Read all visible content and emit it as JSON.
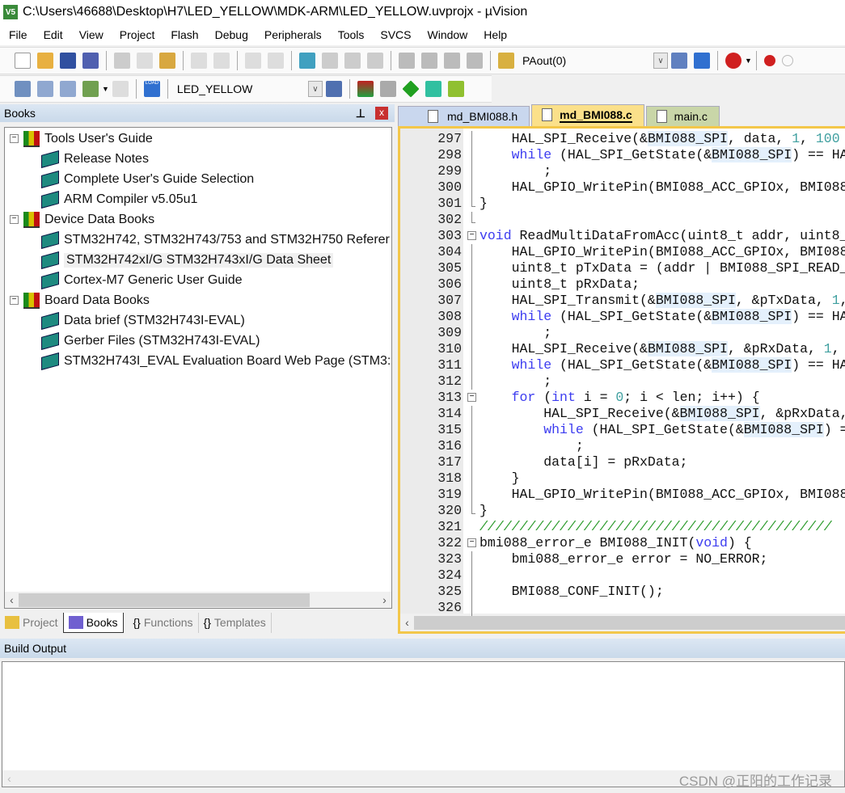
{
  "window": {
    "title": "C:\\Users\\46688\\Desktop\\H7\\LED_YELLOW\\MDK-ARM\\LED_YELLOW.uvprojx - µVision",
    "icon_text": "V5"
  },
  "menu": [
    "File",
    "Edit",
    "View",
    "Project",
    "Flash",
    "Debug",
    "Peripherals",
    "Tools",
    "SVCS",
    "Window",
    "Help"
  ],
  "toolbar1": {
    "find_value": "PAout(0)"
  },
  "toolbar2": {
    "target_value": "LED_YELLOW",
    "load_label": "LOAD"
  },
  "books_panel": {
    "title": "Books",
    "pin": "⊥",
    "close": "x"
  },
  "tree": [
    {
      "label": "Tools User's Guide",
      "level": 0
    },
    {
      "label": "Release Notes",
      "level": 1
    },
    {
      "label": "Complete User's Guide Selection",
      "level": 1
    },
    {
      "label": "ARM Compiler v5.05u1",
      "level": 1
    },
    {
      "label": "Device Data Books",
      "level": 0
    },
    {
      "label": "STM32H742, STM32H743/753 and STM32H750 Referer",
      "level": 1
    },
    {
      "label": "STM32H742xI/G STM32H743xI/G Data Sheet",
      "level": 1,
      "selected": true
    },
    {
      "label": "Cortex-M7 Generic User Guide",
      "level": 1
    },
    {
      "label": "Board Data Books",
      "level": 0
    },
    {
      "label": "Data brief (STM32H743I-EVAL)",
      "level": 1
    },
    {
      "label": "Gerber Files (STM32H743I-EVAL)",
      "level": 1
    },
    {
      "label": "STM32H743I_EVAL Evaluation Board Web Page (STM3:",
      "level": 1
    }
  ],
  "panel_tabs": [
    {
      "label": "Project"
    },
    {
      "label": "Books",
      "active": true
    },
    {
      "label": "Functions",
      "icon": "{}"
    },
    {
      "label": "Templates",
      "icon": "{}"
    }
  ],
  "editor_tabs": [
    {
      "label": "md_BMI088.h",
      "color": "#c9d7ee"
    },
    {
      "label": "md_BMI088.c",
      "color": "#fbe08a",
      "active": true
    },
    {
      "label": "main.c",
      "color": "#c9d6a8"
    }
  ],
  "code_lines": [
    {
      "n": "297",
      "t": [
        [
          "    HAL_SPI_Receive(&",
          ""
        ],
        [
          "BMI088_SPI",
          "hl"
        ],
        [
          ", data, ",
          ""
        ],
        [
          "1",
          "num"
        ],
        [
          ", ",
          ""
        ],
        [
          "100",
          "num"
        ]
      ]
    },
    {
      "n": "298",
      "t": [
        [
          "    ",
          ""
        ],
        [
          "while",
          "kw"
        ],
        [
          " (HAL_SPI_GetState(&",
          ""
        ],
        [
          "BMI088_SPI",
          "hl"
        ],
        [
          ") == HA",
          ""
        ]
      ]
    },
    {
      "n": "299",
      "t": [
        [
          "        ;",
          ""
        ]
      ]
    },
    {
      "n": "300",
      "t": [
        [
          "    HAL_GPIO_WritePin(BMI088_ACC_GPIOx, BMI088",
          ""
        ]
      ]
    },
    {
      "n": "301",
      "t": [
        [
          "}",
          ""
        ]
      ]
    },
    {
      "n": "302",
      "t": []
    },
    {
      "n": "303",
      "fold": "open",
      "t": [
        [
          "void",
          "kw"
        ],
        [
          " ReadMultiDataFromAcc(uint8_t addr, uint8_",
          ""
        ]
      ]
    },
    {
      "n": "304",
      "t": [
        [
          "    HAL_GPIO_WritePin(BMI088_ACC_GPIOx, BMI088",
          ""
        ]
      ]
    },
    {
      "n": "305",
      "t": [
        [
          "    uint8_t pTxData = (addr | BMI088_SPI_READ_",
          ""
        ]
      ]
    },
    {
      "n": "306",
      "t": [
        [
          "    uint8_t pRxData;",
          ""
        ]
      ]
    },
    {
      "n": "307",
      "t": [
        [
          "    HAL_SPI_Transmit(&",
          ""
        ],
        [
          "BMI088_SPI",
          "hl"
        ],
        [
          ", &pTxData, ",
          ""
        ],
        [
          "1",
          "num"
        ],
        [
          ",",
          ""
        ]
      ]
    },
    {
      "n": "308",
      "t": [
        [
          "    ",
          ""
        ],
        [
          "while",
          "kw"
        ],
        [
          " (HAL_SPI_GetState(&",
          ""
        ],
        [
          "BMI088_SPI",
          "hl"
        ],
        [
          ") == HA",
          ""
        ]
      ]
    },
    {
      "n": "309",
      "t": [
        [
          "        ;",
          ""
        ]
      ]
    },
    {
      "n": "310",
      "t": [
        [
          "    HAL_SPI_Receive(&",
          ""
        ],
        [
          "BMI088_SPI",
          "hl"
        ],
        [
          ", &pRxData, ",
          ""
        ],
        [
          "1",
          "num"
        ],
        [
          ",",
          ""
        ]
      ]
    },
    {
      "n": "311",
      "t": [
        [
          "    ",
          ""
        ],
        [
          "while",
          "kw"
        ],
        [
          " (HAL_SPI_GetState(&",
          ""
        ],
        [
          "BMI088_SPI",
          "hl"
        ],
        [
          ") == HA",
          ""
        ]
      ]
    },
    {
      "n": "312",
      "t": [
        [
          "        ;",
          ""
        ]
      ]
    },
    {
      "n": "313",
      "fold": "open",
      "t": [
        [
          "    ",
          ""
        ],
        [
          "for",
          "kw"
        ],
        [
          " (",
          ""
        ],
        [
          "int",
          "kw"
        ],
        [
          " i = ",
          ""
        ],
        [
          "0",
          "num"
        ],
        [
          "; i < len; i++) {",
          ""
        ]
      ]
    },
    {
      "n": "314",
      "t": [
        [
          "        HAL_SPI_Receive(&",
          ""
        ],
        [
          "BMI088_SPI",
          "hl"
        ],
        [
          ", &pRxData,",
          ""
        ]
      ]
    },
    {
      "n": "315",
      "t": [
        [
          "        ",
          ""
        ],
        [
          "while",
          "kw"
        ],
        [
          " (HAL_SPI_GetState(&",
          ""
        ],
        [
          "BMI088_SPI",
          "hl"
        ],
        [
          ") =",
          ""
        ]
      ]
    },
    {
      "n": "316",
      "t": [
        [
          "            ;",
          ""
        ]
      ]
    },
    {
      "n": "317",
      "t": [
        [
          "        data[i] = pRxData;",
          ""
        ]
      ]
    },
    {
      "n": "318",
      "t": [
        [
          "    }",
          ""
        ]
      ]
    },
    {
      "n": "319",
      "t": [
        [
          "    HAL_GPIO_WritePin(BMI088_ACC_GPIOx, BMI088",
          ""
        ]
      ]
    },
    {
      "n": "320",
      "t": [
        [
          "}",
          ""
        ]
      ]
    },
    {
      "n": "321",
      "t": [
        [
          "////////////////////////////////////////////",
          "cm"
        ]
      ]
    },
    {
      "n": "322",
      "fold": "open",
      "t": [
        [
          "bmi088_error_e BMI088_INIT(",
          ""
        ],
        [
          "void",
          "kw"
        ],
        [
          ") {",
          ""
        ]
      ]
    },
    {
      "n": "323",
      "t": [
        [
          "    bmi088_error_e error = NO_ERROR;",
          ""
        ]
      ]
    },
    {
      "n": "324",
      "t": []
    },
    {
      "n": "325",
      "t": [
        [
          "    BMI088_CONF_INIT();",
          ""
        ]
      ]
    },
    {
      "n": "326",
      "t": []
    }
  ],
  "build_output": {
    "title": "Build Output"
  },
  "watermark": "CSDN @正阳的工作记录",
  "colors": {
    "editor_border": "#f3c74a",
    "keyword": "#3c3cf0",
    "number": "#40a0a0",
    "comment": "#2a9a2a",
    "highlight": "#e4f0fc"
  }
}
